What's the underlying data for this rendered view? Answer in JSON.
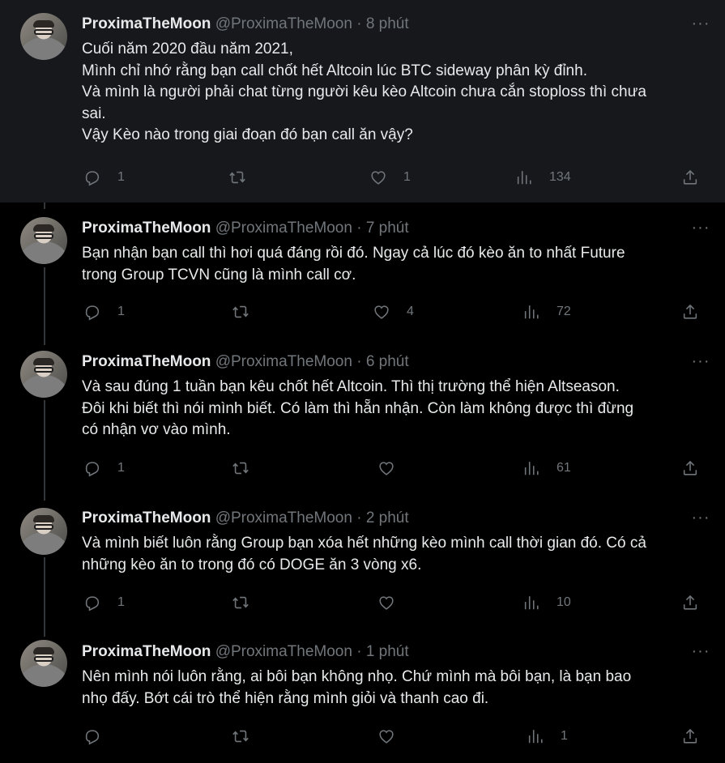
{
  "tweets": [
    {
      "name": "ProximaTheMoon",
      "handle": "@ProximaTheMoon",
      "separator": "·",
      "time": "8 phút",
      "more": "···",
      "lines": [
        "Cuối năm 2020 đầu năm 2021,",
        "Mình chỉ nhớ rằng bạn call chốt hết Altcoin lúc BTC sideway phân kỳ đỉnh.",
        "Và mình là người phải chat từng người kêu kèo Altcoin chưa cắn stoploss thì chưa",
        "sai.",
        "Vậy Kèo nào trong giai đoạn đó bạn call ăn vậy?",
        ""
      ],
      "replies": "1",
      "retweets": "",
      "likes": "1",
      "views": "134"
    },
    {
      "name": "ProximaTheMoon",
      "handle": "@ProximaTheMoon",
      "separator": "·",
      "time": "7 phút",
      "more": "···",
      "lines": [
        "Bạn nhận bạn call thì hơi quá đáng rồi đó. Ngay cả lúc đó kèo ăn to nhất Future",
        "trong Group TCVN cũng là mình call cơ.",
        "",
        "",
        "",
        ""
      ],
      "replies": "1",
      "retweets": "",
      "likes": "4",
      "views": "72"
    },
    {
      "name": "ProximaTheMoon",
      "handle": "@ProximaTheMoon",
      "separator": "·",
      "time": "6 phút",
      "more": "···",
      "lines": [
        "Và sau đúng 1 tuần bạn kêu chốt hết Altcoin. Thì thị trường thể hiện Altseason.",
        "Đôi khi biết thì nói mình biết. Có làm thì hẵn nhận. Còn làm không được thì đừng",
        "có nhận vơ vào mình.",
        "",
        "",
        ""
      ],
      "replies": "1",
      "retweets": "",
      "likes": "",
      "views": "61"
    },
    {
      "name": "ProximaTheMoon",
      "handle": "@ProximaTheMoon",
      "separator": "·",
      "time": "2 phút",
      "more": "···",
      "lines": [
        "Và mình biết luôn rằng Group bạn xóa hết những kèo mình call thời gian đó. Có cả",
        "những kèo ăn to trong đó có DOGE ăn 3 vòng x6.",
        "",
        "",
        "",
        ""
      ],
      "replies": "1",
      "retweets": "",
      "likes": "",
      "views": "10"
    },
    {
      "name": "ProximaTheMoon",
      "handle": "@ProximaTheMoon",
      "separator": "·",
      "time": "1 phút",
      "more": "···",
      "lines": [
        "Nên mình nói luôn rằng, ai bôi bạn không nhọ. Chứ mình mà bôi bạn, là bạn bao",
        "nhọ đấy. Bớt cái trò thể hiện rằng mình giỏi và thanh cao đi.",
        "",
        "",
        "",
        ""
      ],
      "replies": "",
      "retweets": "",
      "likes": "",
      "views": "1"
    }
  ],
  "icons": {
    "reply": "reply-icon",
    "retweet": "retweet-icon",
    "like": "heart-icon",
    "views": "views-chart-icon",
    "share": "share-icon",
    "more": "more-dots-icon"
  },
  "colors": {
    "background": "#000000",
    "highlight_background": "#16181c",
    "text": "#e7e9ea",
    "muted": "#71767b",
    "thread_line": "#333639"
  }
}
